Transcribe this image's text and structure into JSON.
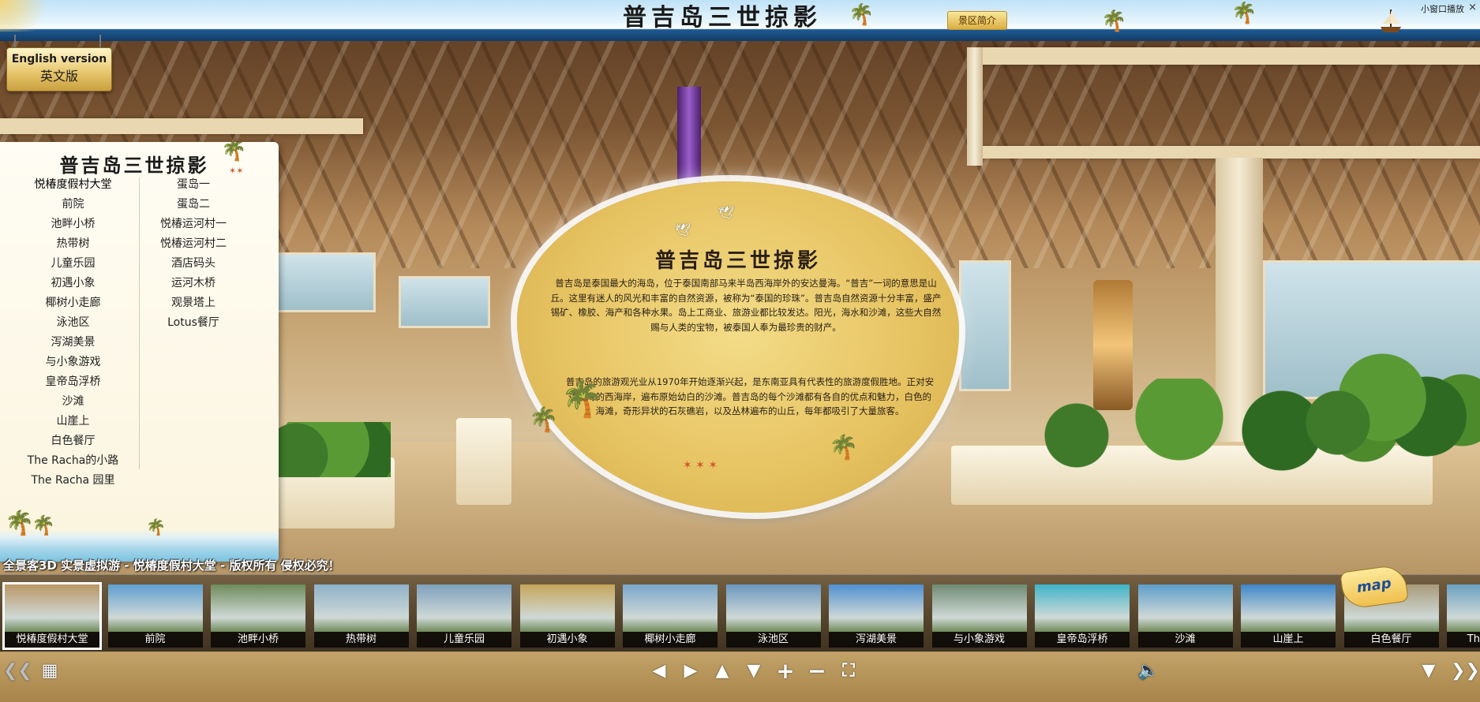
{
  "header": {
    "banner_title": "普吉岛三世掠影",
    "intro_button": "景区简介",
    "small_window_label": "小窗口播放",
    "close_label": "×"
  },
  "language": {
    "english_label": "English version",
    "chinese_label": "英文版"
  },
  "scene_panel": {
    "title": "普吉岛三世掠影",
    "column_left": [
      "悦椿度假村大堂",
      "前院",
      "池畔小桥",
      "热带树",
      "儿童乐园",
      "初遇小象",
      "椰树小走廊",
      "泳池区",
      "泻湖美景",
      "与小象游戏",
      "皇帝岛浮桥",
      "沙滩",
      "山崖上",
      "白色餐厅",
      "The Racha的小路",
      "The Racha 园里"
    ],
    "column_right": [
      "蛋岛一",
      "蛋岛二",
      "悦椿运河村一",
      "悦椿运河村二",
      "酒店码头",
      "运河木桥",
      "观景塔上",
      "Lotus餐厅"
    ]
  },
  "info_card": {
    "title": "普吉岛三世掠影",
    "paragraph1": "普吉岛是泰国最大的海岛，位于泰国南部马来半岛西海岸外的安达曼海。“普吉”一词的意思是山丘。这里有迷人的风光和丰富的自然资源，被称为“泰国的珍珠”。普吉岛自然资源十分丰富，盛产锡矿、橡胶、海产和各种水果。岛上工商业、旅游业都比较发达。阳光，海水和沙滩，这些大自然赐与人类的宝物，被泰国人奉为最珍贵的财产。",
    "paragraph2": "普吉岛的旅游观光业从1970年开始逐渐兴起，是东南亚具有代表性的旅游度假胜地。正对安达曼海的西海岸，遍布原始幼白的沙滩。普吉岛的每个沙滩都有各自的优点和魅力，白色的海滩，奇形异状的石灰礁岩，以及丛林遍布的山丘，每年都吸引了大量旅客。"
  },
  "copyright": "全景客3D 实景虚拟游 - 悦椿度假村大堂 - 版权所有 侵权必究！",
  "thumbnails": [
    {
      "label": "悦椿度假村大堂",
      "color": "#b99767",
      "active": true
    },
    {
      "label": "前院",
      "color": "#5f9fd0"
    },
    {
      "label": "池畔小桥",
      "color": "#6e8b5a"
    },
    {
      "label": "热带树",
      "color": "#8fb1c9"
    },
    {
      "label": "儿童乐园",
      "color": "#7fa0bd"
    },
    {
      "label": "初遇小象",
      "color": "#c4a55b"
    },
    {
      "label": "椰树小走廊",
      "color": "#7aa6c9"
    },
    {
      "label": "泳池区",
      "color": "#6b97bf"
    },
    {
      "label": "泻湖美景",
      "color": "#4f8fcf"
    },
    {
      "label": "与小象游戏",
      "color": "#6f8a73"
    },
    {
      "label": "皇帝岛浮桥",
      "color": "#3fb3c9"
    },
    {
      "label": "沙滩",
      "color": "#5d9ec9"
    },
    {
      "label": "山崖上",
      "color": "#3e86c9"
    },
    {
      "label": "白色餐厅",
      "color": "#a89a7a"
    },
    {
      "label": "The Racha",
      "color": "#6aa0c0"
    }
  ],
  "map_label": "map",
  "controls": {
    "prev": "❮❮",
    "grid": "▦",
    "left": "◀",
    "right": "▶",
    "up": "▲",
    "down": "▼",
    "zoom_in": "+",
    "zoom_out": "−",
    "fullscreen": "⛶",
    "sound": "🔈",
    "collapse": "▼",
    "next": "❯❯"
  }
}
